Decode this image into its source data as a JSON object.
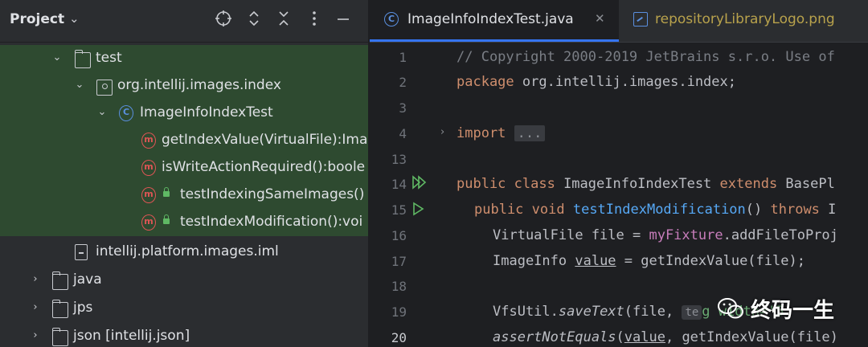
{
  "project_panel": {
    "title": "Project",
    "header_icons": [
      "crosshair-icon",
      "expand-all-icon",
      "collapse-all-icon",
      "more-icon",
      "minimize-icon"
    ],
    "tree": [
      {
        "label": "test",
        "icon": "folder-icon",
        "expanded": true,
        "selected": true
      },
      {
        "label": "org.intellij.images.index",
        "icon": "package-icon",
        "expanded": true,
        "selected": true
      },
      {
        "label": "ImageInfoIndexTest",
        "icon": "class-icon",
        "expanded": true,
        "selected": true
      },
      {
        "label": "getIndexValue(VirtualFile):Ima",
        "icon": "method-icon",
        "selected": true
      },
      {
        "label": "isWriteActionRequired():boole",
        "icon": "method-icon",
        "selected": true
      },
      {
        "label": "testIndexingSameImages()",
        "icon": "test-method-icon",
        "selected": true
      },
      {
        "label": "testIndexModification():voi",
        "icon": "test-method-icon",
        "selected": true
      },
      {
        "label": "intellij.platform.images.iml",
        "icon": "module-file-icon",
        "selected": false
      },
      {
        "label": "java",
        "icon": "folder-icon",
        "expanded": false,
        "selected": false
      },
      {
        "label": "jps",
        "icon": "folder-icon",
        "expanded": false,
        "selected": false
      },
      {
        "label": "json [intellij.json]",
        "icon": "module-folder-icon",
        "expanded": false,
        "selected": false
      }
    ]
  },
  "editor": {
    "tabs": [
      {
        "label": "ImageInfoIndexTest.java",
        "icon": "class-icon",
        "active": true,
        "close": "✕"
      },
      {
        "label": "repositoryLibraryLogo.png",
        "icon": "image-icon",
        "active": false
      }
    ],
    "lines": [
      {
        "n": "1",
        "text": "// Copyright 2000-2019 JetBrains s.r.o. Use of"
      },
      {
        "n": "2",
        "kw": "package",
        "rest": " org.intellij.images.index;"
      },
      {
        "n": "3"
      },
      {
        "n": "4",
        "kw": "import",
        "fold": "..."
      },
      {
        "n": "13"
      },
      {
        "n": "14",
        "kw": "public class",
        "name": " ImageInfoIndexTest ",
        "kw2": "extends",
        "rest": " BasePl"
      },
      {
        "n": "15",
        "kw": "public void",
        "method": "testIndexModification",
        "rest": "() ",
        "kw2": "throws",
        "rest2": " I"
      },
      {
        "n": "16",
        "a": "VirtualFile file = ",
        "field": "myFixture",
        "b": ".addFileToProj"
      },
      {
        "n": "17",
        "a": "ImageInfo ",
        "var": "value",
        "b": " = getIndexValue(file);"
      },
      {
        "n": "18"
      },
      {
        "n": "19",
        "a": "VfsUtil.",
        "static": "saveText",
        "b": "(file, ",
        "hint": "te",
        "str": "g width='5"
      },
      {
        "n": "20",
        "static": "assertNotEquals",
        "b": "(",
        "var": "value",
        "c": ", getIndexValue(file)"
      }
    ]
  },
  "watermark": {
    "text": "终码一生"
  }
}
